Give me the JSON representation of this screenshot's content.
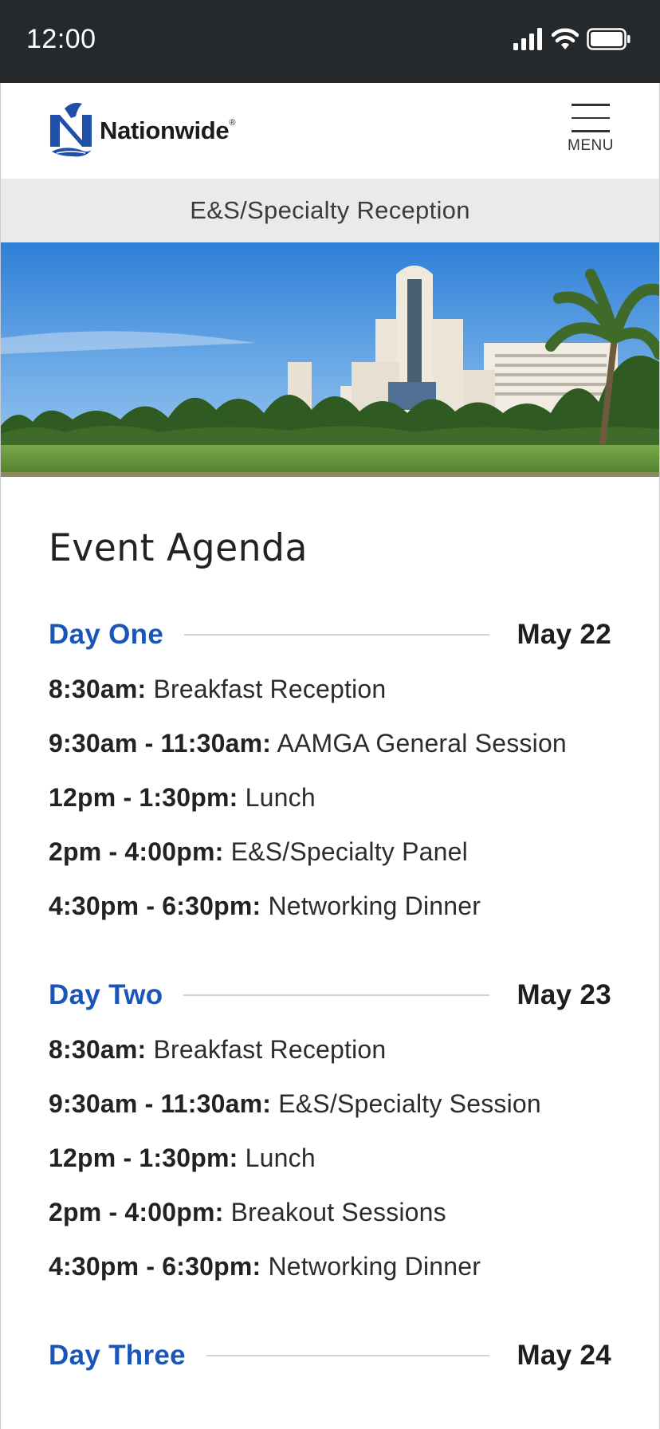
{
  "status_bar": {
    "time": "12:00",
    "icons": [
      "signal-icon",
      "wifi-icon",
      "battery-icon"
    ]
  },
  "header": {
    "logo_text": "Nationwide",
    "logo_registered": "®",
    "menu_label": "MENU"
  },
  "subtitle": "E&S/Specialty Reception",
  "hero": {
    "alt": "Resort hotel with palm trees and golf course"
  },
  "page_title": "Event Agenda",
  "colors": {
    "accent": "#1a56b8",
    "status_bar": "#26292b",
    "subtitle_bg": "#e8eaeb"
  },
  "agenda": [
    {
      "day": "Day One",
      "date": "May 22",
      "items": [
        {
          "time": "8:30am:",
          "desc": "Breakfast Reception"
        },
        {
          "time": "9:30am - 11:30am:",
          "desc": "AAMGA General Session"
        },
        {
          "time": "12pm - 1:30pm:",
          "desc": "Lunch"
        },
        {
          "time": "2pm - 4:00pm:",
          "desc": "E&S/Specialty Panel"
        },
        {
          "time": "4:30pm - 6:30pm:",
          "desc": "Networking Dinner"
        }
      ]
    },
    {
      "day": "Day Two",
      "date": "May 23",
      "items": [
        {
          "time": "8:30am:",
          "desc": "Breakfast Reception"
        },
        {
          "time": "9:30am - 11:30am:",
          "desc": "E&S/Specialty Session"
        },
        {
          "time": "12pm - 1:30pm:",
          "desc": "Lunch"
        },
        {
          "time": "2pm - 4:00pm:",
          "desc": "Breakout Sessions"
        },
        {
          "time": "4:30pm - 6:30pm:",
          "desc": "Networking Dinner"
        }
      ]
    },
    {
      "day": "Day Three",
      "date": "May 24",
      "items": []
    }
  ]
}
